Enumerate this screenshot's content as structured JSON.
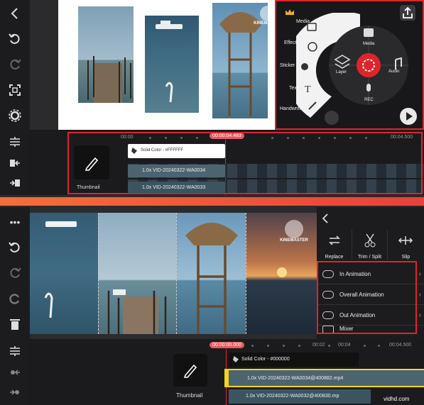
{
  "top": {
    "media_menu": {
      "side_labels": [
        "Media",
        "Effect",
        "Sticker",
        "Text",
        "Handwriting"
      ],
      "wheel": {
        "media": "Media",
        "layer": "Layer",
        "audio": "Audio",
        "rec": "REC"
      }
    },
    "watermark": "KINEMASTER",
    "timeline": {
      "ticks": [
        "00:00",
        "00:04.500"
      ],
      "playhead": "00:00:04.483",
      "thumbnail_label": "Thumbnail",
      "tracks": [
        "Solid Color - #FFFFFF",
        "1.0x VID-20240322-WA0034",
        "1.0x VID-20240322-WA0033"
      ]
    }
  },
  "bottom": {
    "panel": {
      "tools": [
        {
          "label": "Replace"
        },
        {
          "label": "Trim / Split"
        },
        {
          "label": "Slip"
        }
      ],
      "menu": [
        "In Animation",
        "Overall Animation",
        "Out Animation",
        "Mixer"
      ]
    },
    "watermark": "KINEMASTER",
    "timeline": {
      "ticks": [
        "00:02",
        "00:04",
        "00:04.500"
      ],
      "playhead": "00:00:00.000",
      "thumbnail_label": "Thumbnail",
      "tracks": [
        "Solid Color - #000000",
        "1.0x VID-20240322-WA0034@400882.mp4",
        "1.0x VID-20240322-WA0032@400830.mp"
      ]
    }
  },
  "footer_watermark": "vidhd.com",
  "colors": {
    "accent_red": "#e0242b",
    "playhead_bg": "#e65a5e",
    "divider": "#f05a3a",
    "selected_clip": "#f2d51c"
  }
}
